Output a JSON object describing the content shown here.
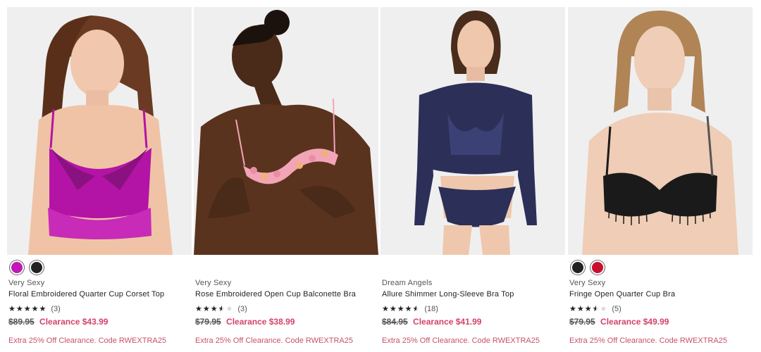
{
  "products": [
    {
      "brand": "Very Sexy",
      "name": "Floral Embroidered Quarter Cup Corset Top",
      "swatches": [
        "#c018b6",
        "#222222"
      ],
      "rating_stars": "★★★★★",
      "rating_value": 5,
      "review_count": "(3)",
      "orig_price": "$89.95",
      "sale_price": "Clearance $43.99",
      "promo": "Extra 25% Off Clearance. Code RWEXTRA25"
    },
    {
      "brand": "Very Sexy",
      "name": "Rose Embroidered Open Cup Balconette Bra",
      "swatches": [],
      "rating_stars": "★★★★★",
      "rating_value": 3.5,
      "review_count": "(3)",
      "orig_price": "$79.95",
      "sale_price": "Clearance $38.99",
      "promo": "Extra 25% Off Clearance. Code RWEXTRA25"
    },
    {
      "brand": "Dream Angels",
      "name": "Allure Shimmer Long-Sleeve Bra Top",
      "swatches": [],
      "rating_stars": "★★★★★",
      "rating_value": 4.5,
      "review_count": "(18)",
      "orig_price": "$84.95",
      "sale_price": "Clearance $41.99",
      "promo": "Extra 25% Off Clearance. Code RWEXTRA25"
    },
    {
      "brand": "Very Sexy",
      "name": "Fringe Open Quarter Cup Bra",
      "swatches": [
        "#222222",
        "#c8102e"
      ],
      "rating_stars": "★★★★★",
      "rating_value": 3.5,
      "review_count": "(5)",
      "orig_price": "$79.95",
      "sale_price": "Clearance $49.99",
      "promo": "Extra 25% Off Clearance. Code RWEXTRA25"
    }
  ]
}
